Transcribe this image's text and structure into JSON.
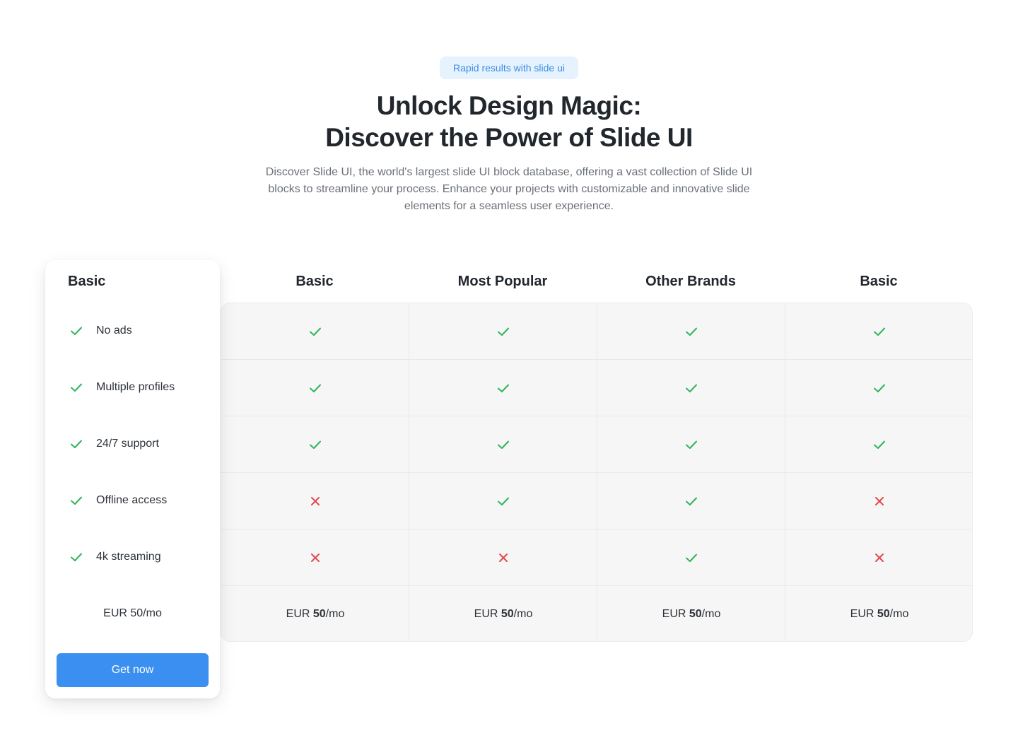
{
  "hero": {
    "badge": "Rapid results with slide ui",
    "title_line1": "Unlock Design Magic:",
    "title_line2": "Discover the Power of Slide UI",
    "description": "Discover Slide UI, the world's largest slide UI block database, offering a vast collection of Slide UI blocks to streamline your process. Enhance your projects with customizable and innovative slide elements for a seamless user experience."
  },
  "card": {
    "title": "Basic",
    "features": [
      "No ads",
      "Multiple profiles",
      "24/7 support",
      "Offline access",
      "4k streaming"
    ],
    "price": "EUR 50/mo",
    "button": "Get now"
  },
  "plans": [
    {
      "name": "Basic",
      "features": [
        true,
        true,
        true,
        false,
        false
      ],
      "price_prefix": "EUR ",
      "price_value": "50",
      "price_suffix": "/mo"
    },
    {
      "name": "Most Popular",
      "features": [
        true,
        true,
        true,
        true,
        false
      ],
      "price_prefix": "EUR ",
      "price_value": "50",
      "price_suffix": "/mo"
    },
    {
      "name": "Other Brands",
      "features": [
        true,
        true,
        true,
        true,
        true
      ],
      "price_prefix": "EUR ",
      "price_value": "50",
      "price_suffix": "/mo"
    },
    {
      "name": "Basic",
      "features": [
        true,
        true,
        true,
        false,
        false
      ],
      "price_prefix": "EUR ",
      "price_value": "50",
      "price_suffix": "/mo"
    }
  ],
  "icons": {
    "included": "check-icon",
    "excluded": "cross-icon"
  },
  "colors": {
    "check": "#2fb55a",
    "cross": "#e5484d",
    "accent": "#3b8ff0",
    "badge_bg": "#e6f2fd",
    "badge_text": "#3a8fe6"
  }
}
